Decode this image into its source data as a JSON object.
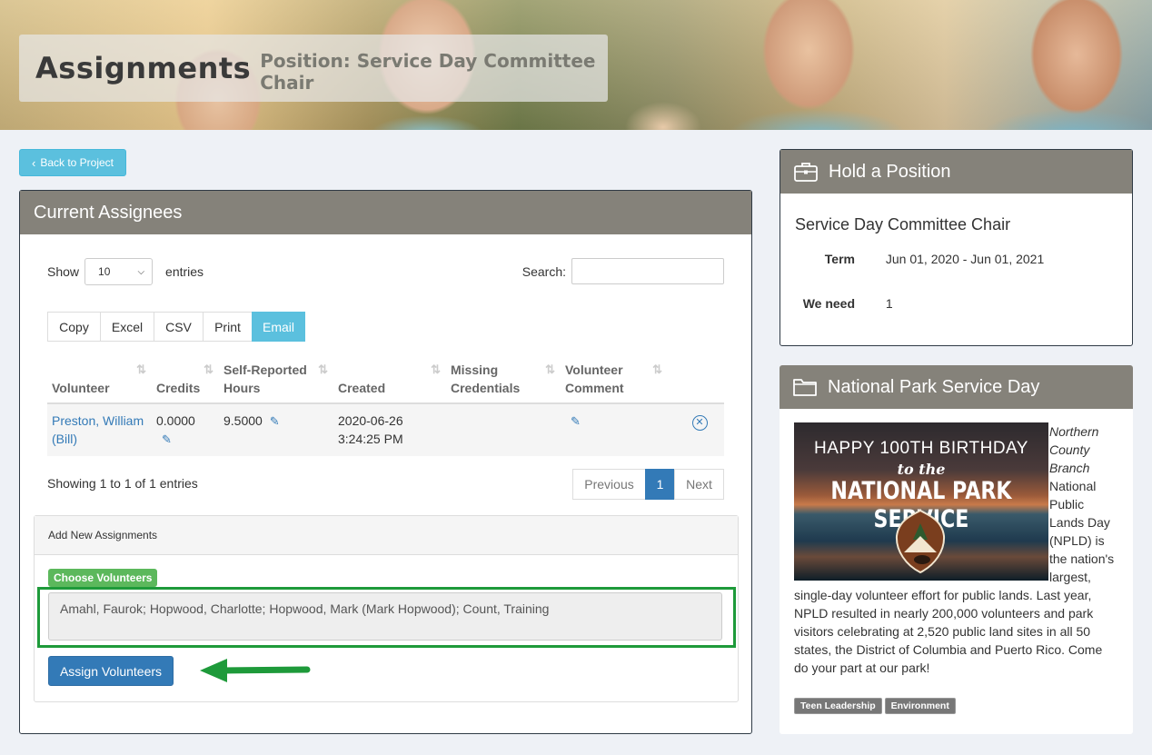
{
  "header": {
    "title": "Assignments",
    "subtitle": "Position: Service Day Committee Chair"
  },
  "back_button": {
    "label": "Back to Project"
  },
  "assignees_panel": {
    "title": "Current Assignees",
    "show_label": "Show",
    "entries_value": "10",
    "entries_label": "entries",
    "search_label": "Search:",
    "search_value": "",
    "export_buttons": [
      "Copy",
      "Excel",
      "CSV",
      "Print",
      "Email"
    ],
    "columns": [
      "Volunteer",
      "Credits",
      "Self-Reported Hours",
      "Created",
      "Missing Credentials",
      "Volunteer Comment"
    ],
    "rows": [
      {
        "volunteer": "Preston, William (Bill)",
        "credits": "0.0000",
        "hours": "9.5000",
        "created_date": "2020-06-26",
        "created_time": "3:24:25 PM",
        "missing_credentials": "",
        "comment": ""
      }
    ],
    "showing_text": "Showing 1 to 1 of 1 entries",
    "pager": {
      "previous": "Previous",
      "current": "1",
      "next": "Next"
    }
  },
  "add_assignments": {
    "title": "Add New Assignments",
    "choose_label": "Choose Volunteers",
    "selected_volunteers": "Amahl, Faurok; Hopwood, Charlotte; Hopwood, Mark (Mark Hopwood); Count, Training",
    "assign_button": "Assign Volunteers"
  },
  "hold_position": {
    "title": "Hold a Position",
    "position_name": "Service Day Committee Chair",
    "term_label": "Term",
    "term_value": "Jun 01, 2020 - Jun 01, 2021",
    "need_label": "We need",
    "need_value": "1"
  },
  "project": {
    "title": "National Park Service Day",
    "image_text": {
      "line1": "HAPPY 100TH BIRTHDAY",
      "line2": "to the",
      "line3": "NATIONAL PARK SERVICE"
    },
    "branch": "Northern County Branch",
    "description": "National Public Lands Day (NPLD) is the nation's largest, single-day volunteer effort for public lands. Last year, NPLD resulted in nearly 200,000 volunteers and park visitors celebrating at 2,520 public land sites in all 50 states, the District of Columbia and Puerto Rico. Come do your part at our park!",
    "tags": [
      "Teen Leadership",
      "Environment"
    ]
  },
  "colors": {
    "panel_header": "#85827a",
    "primary": "#337ab7",
    "info": "#5bc0de",
    "success": "#5cb85c",
    "highlight_box": "#1e9a3a"
  }
}
